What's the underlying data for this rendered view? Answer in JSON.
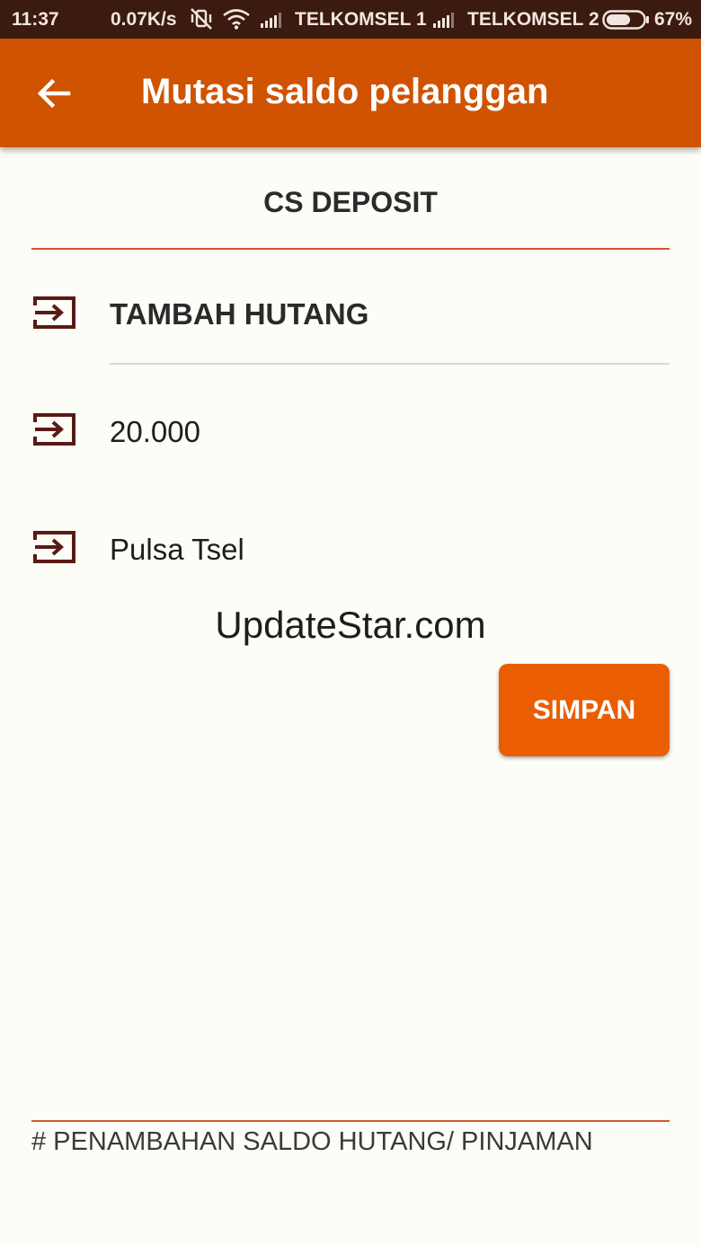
{
  "status_bar": {
    "time": "11:37",
    "net_speed": "0.07K/s",
    "carrier1": "TELKOMSEL 1",
    "carrier2": "TELKOMSEL 2",
    "battery": "67%",
    "battery_level": 0.67,
    "icons": [
      "vibrate-off-icon",
      "wifi-icon",
      "signal-icon",
      "signal-icon",
      "battery-icon"
    ]
  },
  "app_bar": {
    "title": "Mutasi saldo pelanggan",
    "back_icon": "arrow-left-icon"
  },
  "form": {
    "section_title": "CS DEPOSIT",
    "type_select": "TAMBAH HUTANG",
    "amount": "20.000",
    "note": "Pulsa Tsel",
    "row_icon": "input-arrow-icon"
  },
  "watermark": "UpdateStar.com",
  "save_label": "SIMPAN",
  "footer_note": "# PENAMBAHAN SALDO HUTANG/ PINJAMAN",
  "colors": {
    "status_bar": "#3b1a0f",
    "app_bar": "#cf5300",
    "button": "#ea5d00",
    "accent_line": "#d8542f",
    "icon": "#5a1a14",
    "background": "#fdfdf7"
  }
}
